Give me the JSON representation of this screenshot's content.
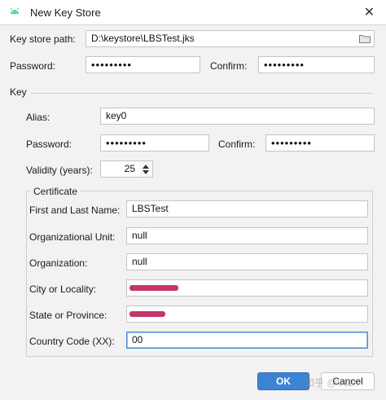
{
  "window": {
    "title": "New Key Store",
    "app_icon": "android-icon",
    "close_icon": "close-icon"
  },
  "keystore": {
    "path_label": "Key store path:",
    "path_value": "D:\\keystore\\LBSTest.jks",
    "password_label": "Password:",
    "password_value": "•••••••••",
    "confirm_label": "Confirm:",
    "confirm_value": "•••••••••"
  },
  "key": {
    "section_label": "Key",
    "alias_label": "Alias:",
    "alias_value": "key0",
    "password_label": "Password:",
    "password_value": "•••••••••",
    "confirm_label": "Confirm:",
    "confirm_value": "•••••••••",
    "validity_label": "Validity (years):",
    "validity_value": "25"
  },
  "certificate": {
    "section_label": "Certificate",
    "first_last_label": "First and Last Name:",
    "first_last_value": "LBSTest",
    "org_unit_label": "Organizational Unit:",
    "org_unit_value": "null",
    "org_label": "Organization:",
    "org_value": "null",
    "city_label": "City or Locality:",
    "state_label": "State or Province:",
    "country_label": "Country Code (XX):",
    "country_value": "00"
  },
  "buttons": {
    "ok": "OK",
    "cancel": "Cancel"
  },
  "watermark": "知乎 @Vs2h",
  "colors": {
    "accent": "#3d83d4",
    "redaction": "#c01f5d",
    "android": "#3ddc84"
  }
}
